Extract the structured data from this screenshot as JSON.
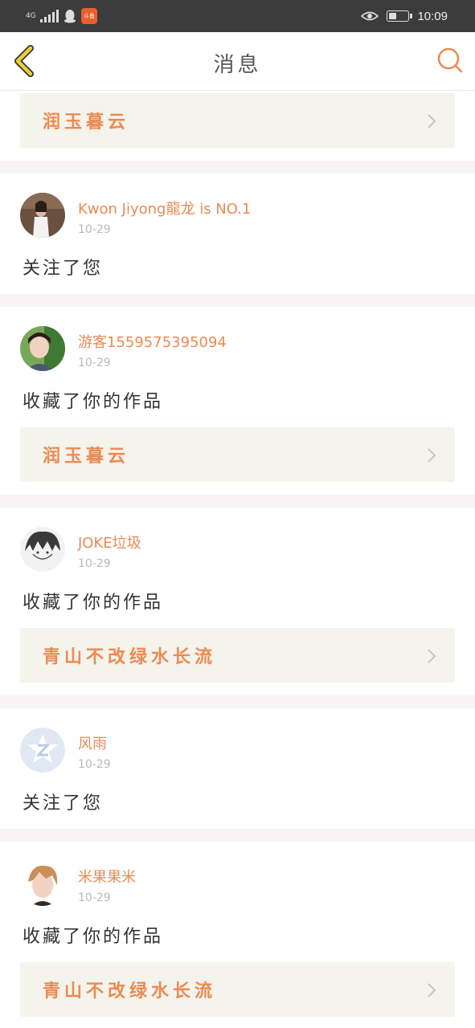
{
  "status_bar": {
    "network": "4G",
    "time": "10:09",
    "app_badge": "斗鱼",
    "battery_level": 0.4
  },
  "nav": {
    "title": "消息",
    "back_icon": "back-chevron-icon",
    "search_icon": "search-icon"
  },
  "top_card": {
    "work": "润玉暮云"
  },
  "messages": [
    {
      "user": "Kwon Jiyong龍龙 is NO.1",
      "date": "10-29",
      "action": "关注了您",
      "avatar": "avatar-photo-girl"
    },
    {
      "user": "游客1559575395094",
      "date": "10-29",
      "action": "收藏了你的作品",
      "work": "润玉暮云",
      "avatar": "avatar-photo-boy"
    },
    {
      "user": "JOKE垃圾",
      "date": "10-29",
      "action": "收藏了你的作品",
      "work": "青山不改绿水长流",
      "avatar": "avatar-anime-sketch"
    },
    {
      "user": "风雨",
      "date": "10-29",
      "action": "关注了您",
      "avatar": "avatar-default-qzone"
    },
    {
      "user": "米果果米",
      "date": "10-29",
      "action": "收藏了你的作品",
      "work": "青山不改绿水长流",
      "avatar": "avatar-photo-man"
    }
  ],
  "colors": {
    "accent": "#ec8a52",
    "card_bg": "#f4f3ec",
    "back_icon": "#e9d23a",
    "status_bar": "#3c3c3c"
  }
}
